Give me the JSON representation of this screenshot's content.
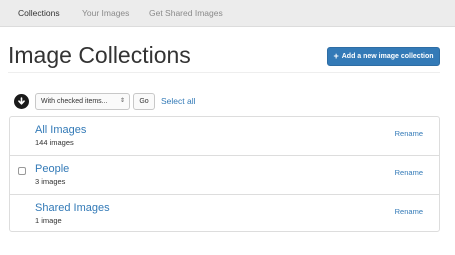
{
  "nav": {
    "tabs": [
      {
        "label": "Collections"
      },
      {
        "label": "Your Images"
      },
      {
        "label": "Get Shared Images"
      }
    ]
  },
  "header": {
    "title": "Image Collections",
    "add_button_label": "Add a new image collection",
    "add_button_icon": "plus-icon"
  },
  "toolbar": {
    "bulk_action_icon": "arrow-down-circle-icon",
    "bulk_select_value": "With checked items...",
    "go_label": "Go",
    "select_all_label": "Select all"
  },
  "collections": [
    {
      "name": "All Images",
      "count": "144 images",
      "rename_label": "Rename",
      "has_checkbox": false
    },
    {
      "name": "People",
      "count": "3 images",
      "rename_label": "Rename",
      "has_checkbox": true
    },
    {
      "name": "Shared Images",
      "count": "1 image",
      "rename_label": "Rename",
      "has_checkbox": false
    }
  ],
  "colors": {
    "accent": "#337ab7",
    "nav_background": "#ececec"
  }
}
